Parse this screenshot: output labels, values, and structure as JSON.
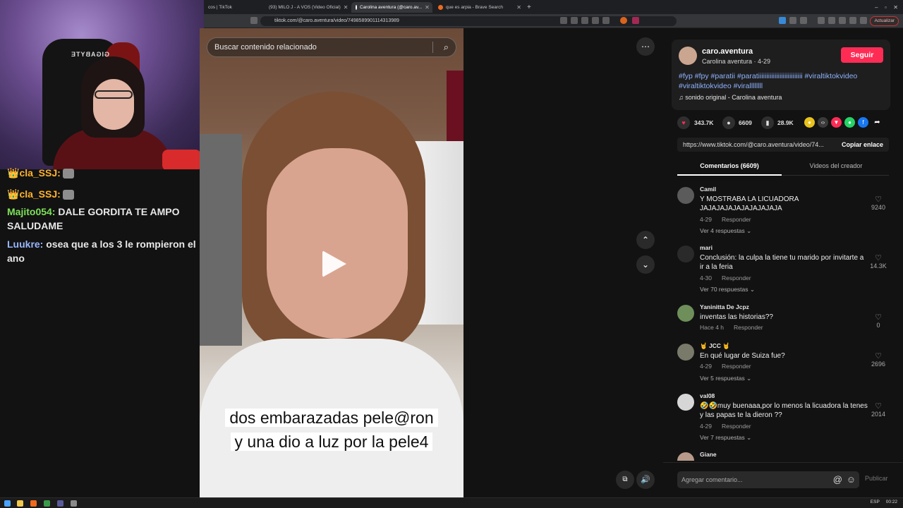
{
  "browser": {
    "tabs": [
      {
        "label": "cos | TikTok"
      },
      {
        "label": "(93) MILO J - A VOS (Video Oficial)"
      },
      {
        "label": "Carolina aventura (@caro.av..."
      },
      {
        "label": "que es arpia - Brave Search"
      }
    ],
    "url": "tiktok.com/@caro.aventura/video/7498589901114313989",
    "update_label": "Actualizar"
  },
  "chat": {
    "messages": [
      {
        "user": "cla_SSJ:",
        "text": ""
      },
      {
        "user": "cla_SSJ:",
        "text": ""
      },
      {
        "user": "Majito054:",
        "text": "DALE GORDITA TE AMPO SALUDAME"
      },
      {
        "user": "Luukre:",
        "text": "osea que a los 3 le rompieron el ano"
      }
    ]
  },
  "webcam": {
    "chair_brand": "GIGABYTE"
  },
  "video": {
    "search_placeholder": "Buscar contenido relacionado",
    "caption_line1": "dos embarazadas pele@ron",
    "caption_line2": "y una dio a luz por la pele4",
    "more_icon": "⋯",
    "up_icon": "⌃",
    "down_icon": "⌄"
  },
  "post": {
    "username": "caro.aventura",
    "display_name": "Carolina aventura",
    "date": "4-29",
    "follow_label": "Seguir",
    "hashtags": "#fyp #fpy #paratii #paratiiiiiiiiiiiiiiiiiiiiiiiiiii #viraltiktokvideo #viraltiktokvideo #virallllllll",
    "sound": "sonido original - Carolina aventura",
    "likes": "343.7K",
    "comments": "6609",
    "saves": "28.9K",
    "share_url": "https://www.tiktok.com/@caro.aventura/video/74...",
    "copy_label": "Copiar enlace"
  },
  "tabs": {
    "comments_label": "Comentarios (6609)",
    "creator_label": "Videos del creador"
  },
  "comments": [
    {
      "user": "Camil",
      "text": "Y MOSTRABA LA LICUADORA JAJAJAJAJAJAJAJAJAJA",
      "date": "4-29",
      "reply": "Responder",
      "replies": "Ver 4 respuestas",
      "likes": "9240"
    },
    {
      "user": "mari",
      "text": "Conclusión: la culpa la tiene tu marido por invitarte a ir a la feria",
      "date": "4-30",
      "reply": "Responder",
      "replies": "Ver 70 respuestas",
      "likes": "14.3K"
    },
    {
      "user": "Yaninitta De Jcpz",
      "text": "inventas las historias??",
      "date": "Hace 4 h",
      "reply": "Responder",
      "replies": "",
      "likes": "0"
    },
    {
      "user": "🤘 JCC 🤘",
      "text": "En qué lugar de Suiza fue?",
      "date": "4-29",
      "reply": "Responder",
      "replies": "Ver 5 respuestas",
      "likes": "2696"
    },
    {
      "user": "val08",
      "text": "🤣🤣muy buenaaa,por lo menos la licuadora la tenes y las papas te la dieron ??",
      "date": "4-29",
      "reply": "Responder",
      "replies": "Ver 7 respuestas",
      "likes": "2014"
    },
    {
      "user": "Giane",
      "text": "",
      "date": "",
      "reply": "",
      "replies": "",
      "likes": ""
    }
  ],
  "composer": {
    "placeholder": "Agregar comentario...",
    "publish_label": "Publicar"
  },
  "taskbar": {
    "lang": "ESP",
    "time": "00:22"
  },
  "colors": {
    "accent": "#fe2c55",
    "hashtag": "#8fb3ff",
    "bg": "#121212"
  }
}
